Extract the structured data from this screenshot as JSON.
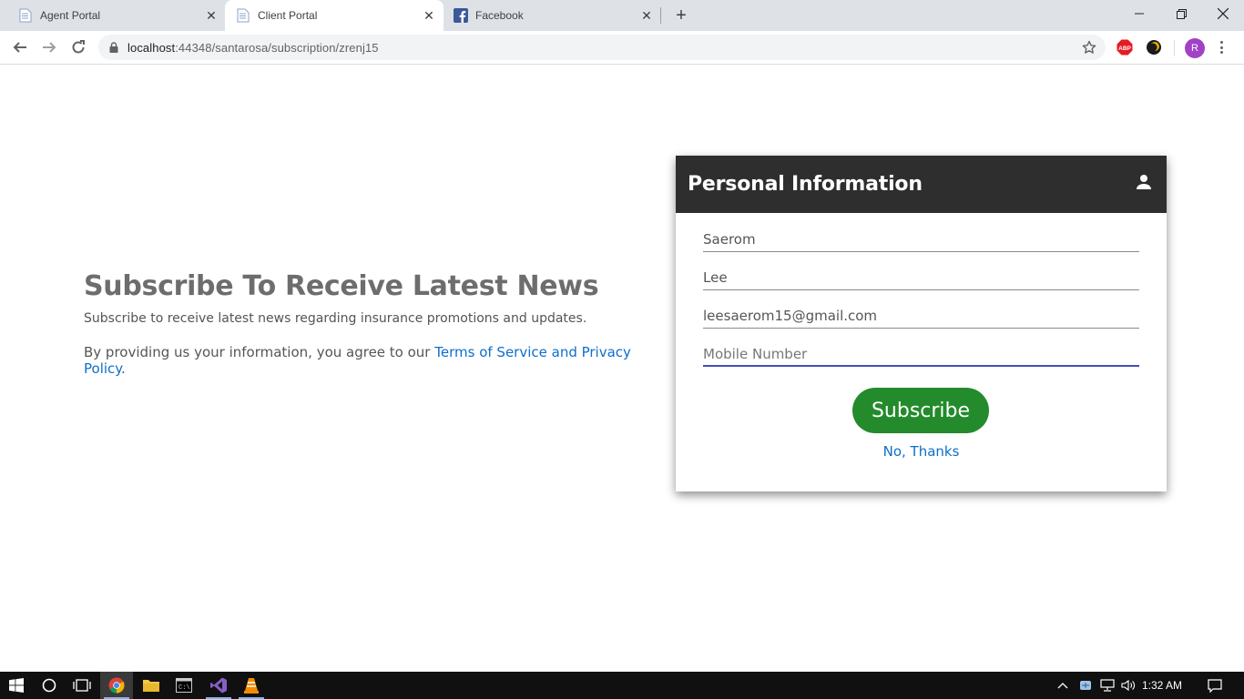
{
  "browser": {
    "tabs": [
      {
        "title": "Agent Portal",
        "icon": "page-icon",
        "active": false
      },
      {
        "title": "Client Portal",
        "icon": "page-icon",
        "active": true
      },
      {
        "title": "Facebook",
        "icon": "facebook-icon",
        "active": false
      }
    ],
    "address": {
      "host": "localhost",
      "path": ":44348/santarosa/subscription/zrenj15"
    },
    "profile_initial": "R",
    "extensions": [
      "adblock-plus-icon",
      "extension-dark-icon"
    ]
  },
  "hero": {
    "heading": "Subscribe To Receive Latest News",
    "description": "Subscribe to receive latest news regarding insurance promotions and updates.",
    "agree_prefix": "By providing us your information, you agree to our ",
    "agree_link": "Terms of Service and Privacy Policy",
    "agree_suffix": "."
  },
  "form": {
    "title": "Personal Information",
    "header_icon": "person-icon",
    "fields": [
      {
        "name": "first_name",
        "value": "Saerom",
        "placeholder": ""
      },
      {
        "name": "last_name",
        "value": "Lee",
        "placeholder": ""
      },
      {
        "name": "email",
        "value": "leesaerom15@gmail.com",
        "placeholder": ""
      },
      {
        "name": "mobile",
        "value": "",
        "placeholder": "Mobile Number"
      }
    ],
    "subscribe_label": "Subscribe",
    "decline_label": "No, Thanks"
  },
  "taskbar": {
    "apps": [
      "start-icon",
      "search-circle-icon",
      "task-view-icon",
      "chrome-icon",
      "file-explorer-icon",
      "cmd-icon",
      "visual-studio-icon",
      "vlc-icon"
    ],
    "time": "1:32 AM"
  },
  "colors": {
    "card_header": "#2e2e2e",
    "subscribe_button": "#238b2b",
    "link": "#0d6fc9",
    "focus_underline": "#3f51b5"
  }
}
